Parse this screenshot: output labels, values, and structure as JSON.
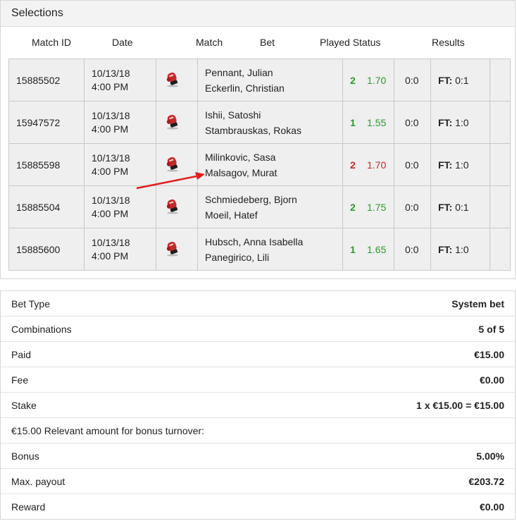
{
  "selections": {
    "title": "Selections",
    "headers": {
      "match_id": "Match ID",
      "date": "Date",
      "match": "Match",
      "bet": "Bet",
      "played_status": "Played Status",
      "results": "Results"
    },
    "rows": [
      {
        "match_id": "15885502",
        "date": "10/13/18",
        "time": "4:00 PM",
        "home": "Pennant, Julian",
        "away": "Eckerlin, Christian",
        "tip": "2",
        "odd": "1.70",
        "status": "green",
        "played": "0:0",
        "ft_label": "FT:",
        "ft_score": "0:1",
        "icon": "boxing-glove-icon"
      },
      {
        "match_id": "15947572",
        "date": "10/13/18",
        "time": "4:00 PM",
        "home": "Ishii, Satoshi",
        "away": "Stambrauskas, Rokas",
        "tip": "1",
        "odd": "1.55",
        "status": "green",
        "played": "0:0",
        "ft_label": "FT:",
        "ft_score": "1:0",
        "icon": "boxing-glove-icon"
      },
      {
        "match_id": "15885598",
        "date": "10/13/18",
        "time": "4:00 PM",
        "home": "Milinkovic, Sasa",
        "away": "Malsagov, Murat",
        "tip": "2",
        "odd": "1.70",
        "status": "red",
        "played": "0:0",
        "ft_label": "FT:",
        "ft_score": "1:0",
        "icon": "boxing-glove-icon"
      },
      {
        "match_id": "15885504",
        "date": "10/13/18",
        "time": "4:00 PM",
        "home": "Schmiedeberg, Bjorn",
        "away": "Moeil, Hatef",
        "tip": "2",
        "odd": "1.75",
        "status": "green",
        "played": "0:0",
        "ft_label": "FT:",
        "ft_score": "0:1",
        "icon": "boxing-glove-icon"
      },
      {
        "match_id": "15885600",
        "date": "10/13/18",
        "time": "4:00 PM",
        "home": "Hubsch, Anna Isabella",
        "away": "Panegirico, Lili",
        "tip": "1",
        "odd": "1.65",
        "status": "green",
        "played": "0:0",
        "ft_label": "FT:",
        "ft_score": "1:0",
        "icon": "boxing-glove-icon"
      }
    ],
    "colors": {
      "win": "#2e9a2e",
      "loss": "#c62828",
      "annotation_arrow": "#e02020"
    }
  },
  "summary": {
    "rows": [
      {
        "label": "Bet Type",
        "value": "System bet"
      },
      {
        "label": "Combinations",
        "value": "5 of 5"
      },
      {
        "label": "Paid",
        "value": "€15.00"
      },
      {
        "label": "Fee",
        "value": "€0.00"
      },
      {
        "label": "Stake",
        "value": "1 x €15.00 = €15.00"
      },
      {
        "label": "€15.00 Relevant amount for bonus turnover:",
        "value": ""
      },
      {
        "label": "Bonus",
        "value": "5.00%"
      },
      {
        "label": "Max. payout",
        "value": "€203.72"
      },
      {
        "label": "Reward",
        "value": "€0.00"
      }
    ]
  }
}
